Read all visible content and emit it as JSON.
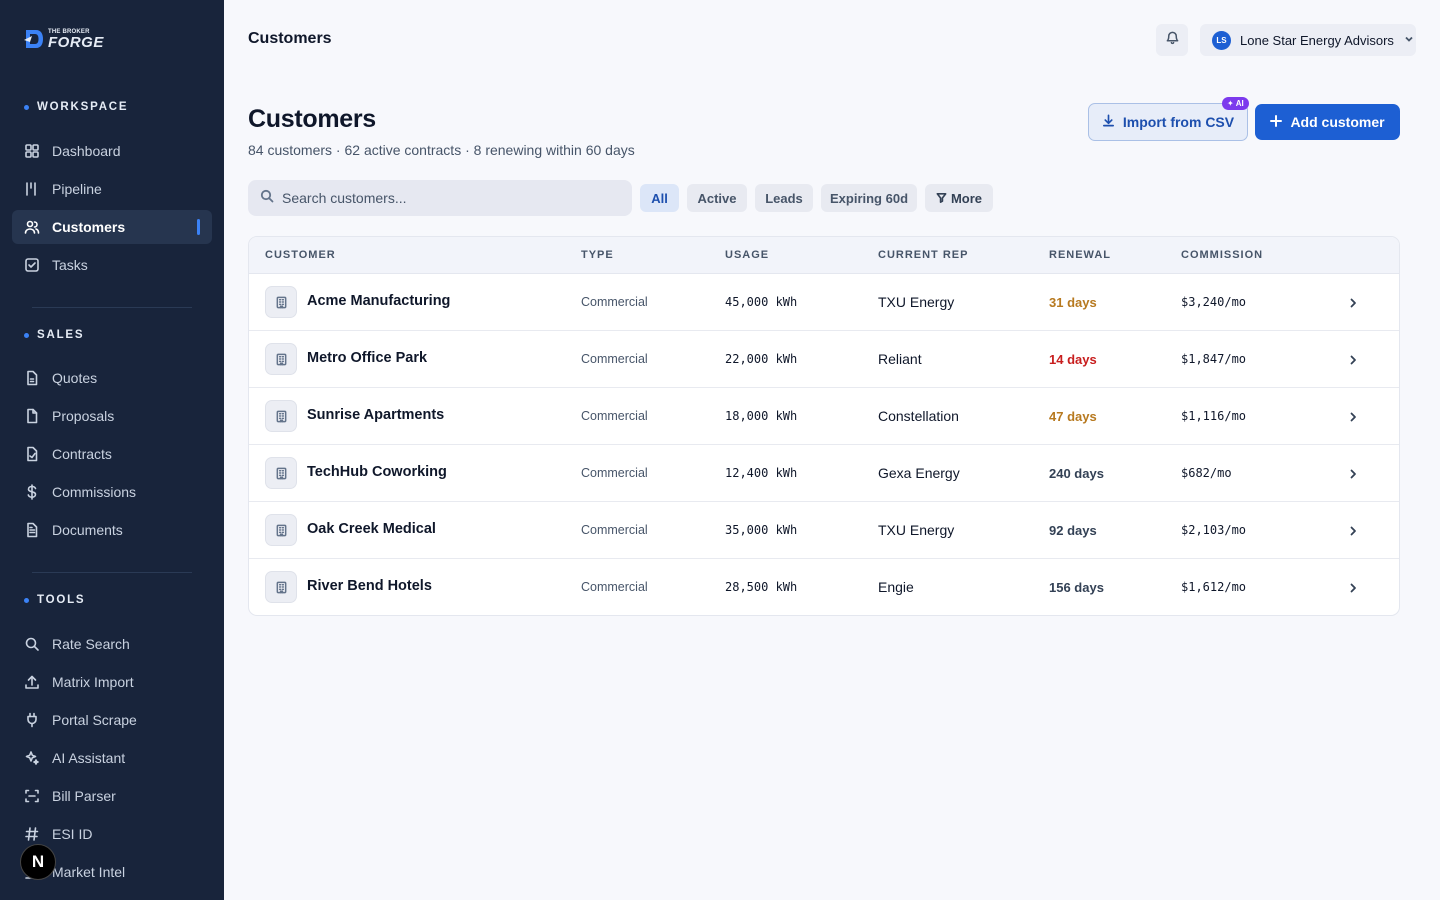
{
  "brand": {
    "small": "THE BROKER",
    "big": "FORGE"
  },
  "sidebar": {
    "sections": [
      {
        "label": "WORKSPACE",
        "items": [
          {
            "label": "Dashboard",
            "icon": "grid-icon"
          },
          {
            "label": "Pipeline",
            "icon": "pipeline-icon"
          },
          {
            "label": "Customers",
            "icon": "users-icon",
            "active": true
          },
          {
            "label": "Tasks",
            "icon": "checkbox-icon"
          }
        ]
      },
      {
        "label": "SALES",
        "items": [
          {
            "label": "Quotes",
            "icon": "quote-file-icon"
          },
          {
            "label": "Proposals",
            "icon": "proposal-file-icon"
          },
          {
            "label": "Contracts",
            "icon": "contract-icon"
          },
          {
            "label": "Commissions",
            "icon": "dollar-icon"
          },
          {
            "label": "Documents",
            "icon": "document-icon"
          }
        ]
      },
      {
        "label": "TOOLS",
        "items": [
          {
            "label": "Rate Search",
            "icon": "search-icon"
          },
          {
            "label": "Matrix Import",
            "icon": "upload-icon"
          },
          {
            "label": "Portal Scrape",
            "icon": "plug-icon"
          },
          {
            "label": "AI Assistant",
            "icon": "sparkles-icon"
          },
          {
            "label": "Bill Parser",
            "icon": "scan-icon"
          },
          {
            "label": "ESI ID",
            "icon": "hash-icon"
          },
          {
            "label": "Market Intel",
            "icon": "chart-icon"
          }
        ]
      }
    ],
    "floating_badge": "N"
  },
  "topbar": {
    "title": "Customers",
    "account": {
      "initials": "LS",
      "name": "Lone Star Energy Advisors"
    }
  },
  "header": {
    "title": "Customers",
    "subtitle": "84 customers · 62 active contracts · 8 renewing within 60 days",
    "import_label": "Import from CSV",
    "ai_badge": "AI",
    "add_label": "Add customer"
  },
  "search": {
    "placeholder": "Search customers..."
  },
  "filters": [
    "All",
    "Active",
    "Leads",
    "Expiring 60d"
  ],
  "more_label": "More",
  "table": {
    "columns": [
      "CUSTOMER",
      "TYPE",
      "USAGE",
      "CURRENT REP",
      "RENEWAL",
      "COMMISSION"
    ],
    "rows": [
      {
        "name": "Acme Manufacturing",
        "type": "Commercial",
        "usage": "45,000 kWh",
        "rep": "TXU Energy",
        "renewal": "31 days",
        "renewal_status": "warning",
        "commission": "$3,240/mo"
      },
      {
        "name": "Metro Office Park",
        "type": "Commercial",
        "usage": "22,000 kWh",
        "rep": "Reliant",
        "renewal": "14 days",
        "renewal_status": "urgent",
        "commission": "$1,847/mo"
      },
      {
        "name": "Sunrise Apartments",
        "type": "Commercial",
        "usage": "18,000 kWh",
        "rep": "Constellation",
        "renewal": "47 days",
        "renewal_status": "warning",
        "commission": "$1,116/mo"
      },
      {
        "name": "TechHub Coworking",
        "type": "Commercial",
        "usage": "12,400 kWh",
        "rep": "Gexa Energy",
        "renewal": "240 days",
        "renewal_status": "normal",
        "commission": "$682/mo"
      },
      {
        "name": "Oak Creek Medical",
        "type": "Commercial",
        "usage": "35,000 kWh",
        "rep": "TXU Energy",
        "renewal": "92 days",
        "renewal_status": "normal",
        "commission": "$2,103/mo"
      },
      {
        "name": "River Bend Hotels",
        "type": "Commercial",
        "usage": "28,500 kWh",
        "rep": "Engie",
        "renewal": "156 days",
        "renewal_status": "normal",
        "commission": "$1,612/mo"
      }
    ]
  },
  "colors": {
    "sidebar_bg": "#18243b",
    "accent": "#1d5fd3",
    "renewal_warning": "#b7791f",
    "renewal_urgent": "#c81e1e",
    "renewal_normal": "#334155"
  }
}
